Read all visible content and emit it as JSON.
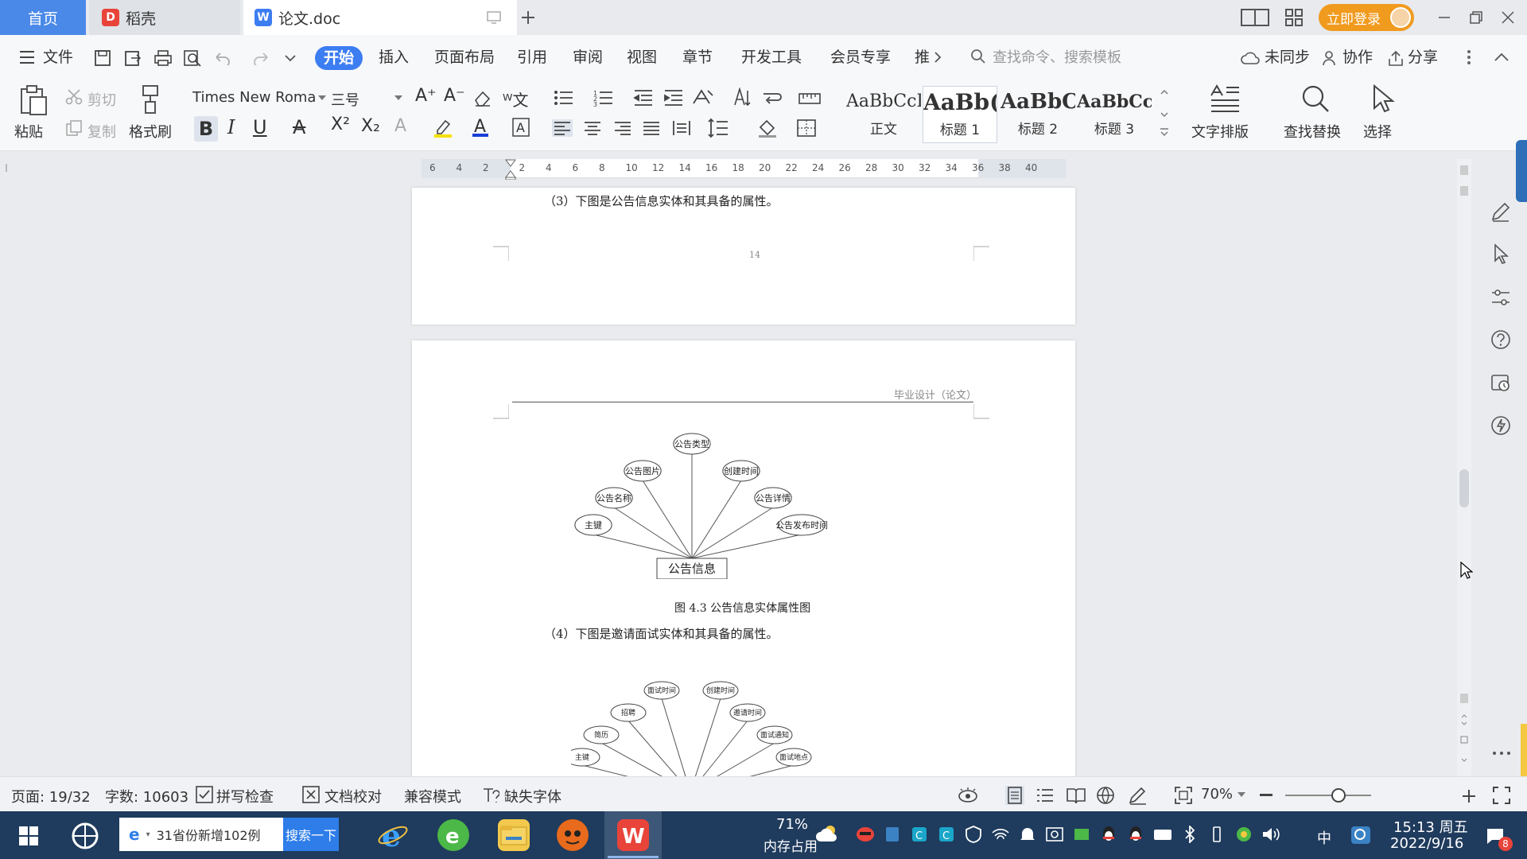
{
  "title_bar": {
    "tab_home": "首页",
    "tab_daoke": "稻壳",
    "tab_doc": "论文.doc",
    "login_button": "立即登录"
  },
  "menu": {
    "file": "文件",
    "items": [
      "开始",
      "插入",
      "页面布局",
      "引用",
      "审阅",
      "视图",
      "章节",
      "开发工具",
      "会员专享",
      "推"
    ],
    "search_placeholder": "查找命令、搜索模板",
    "unsynced": "未同步",
    "collab": "协作",
    "share": "分享"
  },
  "ribbon": {
    "paste": "粘贴",
    "cut": "剪切",
    "copy": "复制",
    "format_painter": "格式刷",
    "font_name": "Times New Roma",
    "font_size": "三号",
    "styles": [
      {
        "sample": "AaBbCcI",
        "name": "正文"
      },
      {
        "sample": "AaBb(",
        "name": "标题 1"
      },
      {
        "sample": "AaBbC",
        "name": "标题 2"
      },
      {
        "sample": "AaBbCcl",
        "name": "标题 3"
      }
    ],
    "text_layout": "文字排版",
    "find_replace": "查找替换",
    "select": "选择"
  },
  "ruler_ticks": [
    "6",
    "4",
    "2",
    "2",
    "4",
    "6",
    "8",
    "10",
    "12",
    "14",
    "16",
    "18",
    "20",
    "22",
    "24",
    "26",
    "28",
    "30",
    "32",
    "34",
    "36",
    "38",
    "40"
  ],
  "document": {
    "para3": "（3）下图是公告信息实体和其具备的属性。",
    "page_num": "14",
    "header_text": "毕业设计（论文）",
    "diagram1": {
      "entity": "公告信息",
      "attributes": [
        "公告类型",
        "公告图片",
        "创建时间",
        "公告名称",
        "公告详情",
        "主键",
        "公告发布时间"
      ]
    },
    "caption1": "图 4.3 公告信息实体属性图",
    "para4": "（4）下图是邀请面试实体和其具备的属性。",
    "diagram2": {
      "attributes": [
        "面试时间",
        "创建时间",
        "招聘",
        "邀请时间",
        "简历",
        "面试通知",
        "主键",
        "面试地点"
      ]
    }
  },
  "status": {
    "page": "页面: 19/32",
    "words": "字数: 10603",
    "spell": "拼写检查",
    "proof": "文档校对",
    "compat": "兼容模式",
    "missing_font": "缺失字体",
    "zoom": "70%"
  },
  "taskbar": {
    "news": "31省份新增102例",
    "search_btn": "搜索一下",
    "mem_percent": "71%",
    "mem_label": "内存占用",
    "ime": "中",
    "time": "15:13 周五",
    "date": "2022/9/16",
    "notif_count": "8"
  }
}
